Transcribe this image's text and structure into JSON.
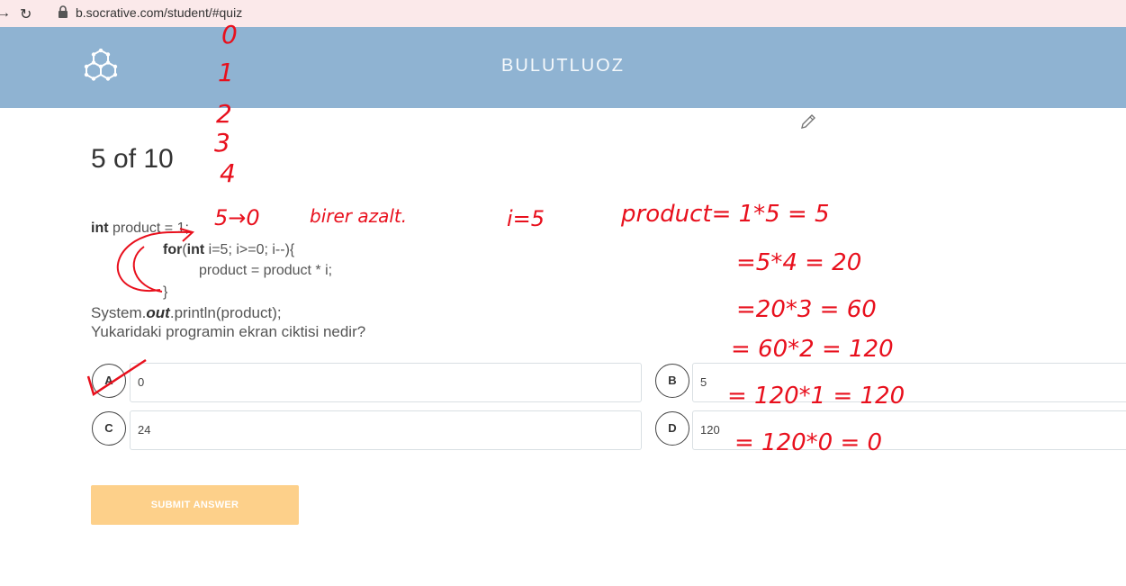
{
  "browser": {
    "url": "b.socrative.com/student/#quiz",
    "icons": [
      "back-arrow-icon",
      "reload-icon",
      "lock-icon"
    ]
  },
  "header": {
    "room_name": "BULUTLUOZ",
    "logo_icon": "socrative-hexagon-logo-icon",
    "background": "#8fb3d2"
  },
  "quiz": {
    "counter": "5 of 10",
    "code": {
      "l1_kw": "int",
      "l1_rest": " product = 1;",
      "l2_kw1": "for",
      "l2_a": "(",
      "l2_kw2": "int",
      "l2_b": " i=5; i>=0; i--){",
      "l3": "product = product * i;",
      "l4": "}",
      "l5_a": "System.",
      "l5_out": "out",
      "l5_b": ".println(product);"
    },
    "question": "Yukaridaki programin ekran ciktisi nedir?",
    "answers": [
      {
        "letter": "A",
        "text": "0"
      },
      {
        "letter": "B",
        "text": "5"
      },
      {
        "letter": "C",
        "text": "24"
      },
      {
        "letter": "D",
        "text": "120"
      }
    ],
    "submit_label": "SUBMIT ANSWER",
    "submit_color": "#fdd08a"
  },
  "annotations": {
    "color": "#e8101d",
    "countdown": [
      "0",
      "1",
      "2",
      "3",
      "4"
    ],
    "five_to_zero": "5→0",
    "note": "birer azalt.",
    "i_value": "i=5",
    "steps": [
      "product= 1*5 = 5",
      "=5*4 = 20",
      "=20*3 = 60",
      "= 60*2 = 120",
      "= 120*1 = 120",
      "= 120*0 = 0"
    ]
  }
}
